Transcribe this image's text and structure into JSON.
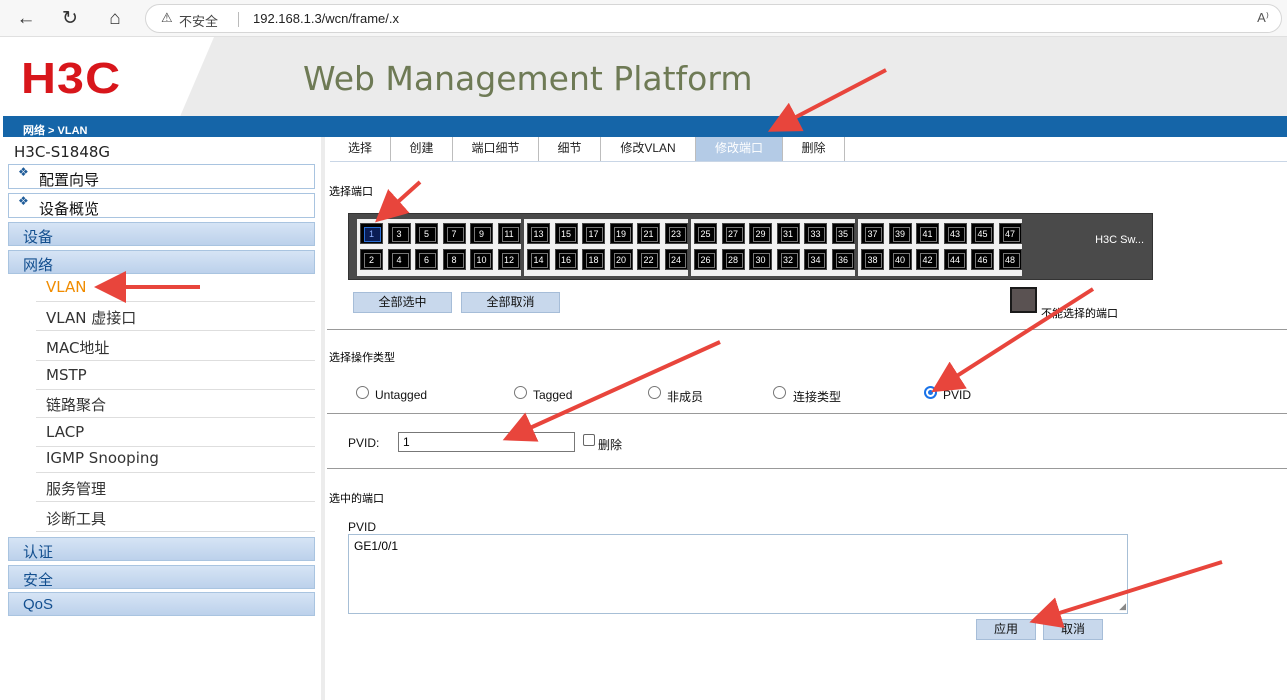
{
  "browser": {
    "back_icon": "←",
    "refresh_icon": "↻",
    "home_icon": "⌂",
    "warning_icon": "⚠",
    "insecure_label": "不安全",
    "url": "192.168.1.3/wcn/frame/.x",
    "read_aloud_icon": "A⁾"
  },
  "header": {
    "logo": "H3C",
    "title": "Web Management Platform",
    "breadcrumb": "网络 > VLAN"
  },
  "sidebar": {
    "device_name": "H3C-S1848G",
    "box_items": [
      {
        "label": "配置向导"
      },
      {
        "label": "设备概览"
      }
    ],
    "sections": {
      "device": "设备",
      "network": "网络",
      "auth": "认证",
      "security": "安全",
      "qos": "QoS"
    },
    "network_items": [
      {
        "label": "VLAN"
      },
      {
        "label": "VLAN 虚接口"
      },
      {
        "label": "MAC地址"
      },
      {
        "label": "MSTP"
      },
      {
        "label": "链路聚合"
      },
      {
        "label": "LACP"
      },
      {
        "label": "IGMP Snooping"
      },
      {
        "label": "服务管理"
      },
      {
        "label": "诊断工具"
      }
    ],
    "active_item": "VLAN"
  },
  "tabs": [
    {
      "label": "选择"
    },
    {
      "label": "创建"
    },
    {
      "label": "端口细节"
    },
    {
      "label": "细节"
    },
    {
      "label": "修改VLAN"
    },
    {
      "label": "修改端口"
    },
    {
      "label": "删除"
    }
  ],
  "active_tab": "修改端口",
  "select_ports": {
    "heading": "选择端口",
    "switch_label": "H3C Sw...",
    "top_row": [
      "1",
      "3",
      "5",
      "7",
      "9",
      "11",
      "13",
      "15",
      "17",
      "19",
      "21",
      "23",
      "25",
      "27",
      "29",
      "31",
      "33",
      "35",
      "37",
      "39",
      "41",
      "43",
      "45",
      "47"
    ],
    "bottom_row": [
      "2",
      "4",
      "6",
      "8",
      "10",
      "12",
      "14",
      "16",
      "18",
      "20",
      "22",
      "24",
      "26",
      "28",
      "30",
      "32",
      "34",
      "36",
      "38",
      "40",
      "42",
      "44",
      "46",
      "48"
    ],
    "selected_ports": [
      "1"
    ],
    "select_all": "全部选中",
    "deselect_all": "全部取消",
    "legend_unselectable": "不能选择的端口"
  },
  "operation": {
    "heading": "选择操作类型",
    "options": [
      {
        "label": "Untagged",
        "checked": false
      },
      {
        "label": "Tagged",
        "checked": false
      },
      {
        "label": "非成员",
        "checked": false
      },
      {
        "label": "连接类型",
        "checked": false
      },
      {
        "label": "PVID",
        "checked": true
      }
    ]
  },
  "pvid": {
    "label": "PVID:",
    "value": "1",
    "delete_label": "删除",
    "delete_checked": false
  },
  "selected": {
    "heading": "选中的端口",
    "type_label": "PVID",
    "ports_text": "GE1/0/1"
  },
  "actions": {
    "apply": "应用",
    "cancel": "取消"
  },
  "colors": {
    "brand_red": "#d8161b",
    "nav_blue": "#1565a8",
    "active_orange": "#f08c00",
    "annotation_red": "#e8453c"
  }
}
